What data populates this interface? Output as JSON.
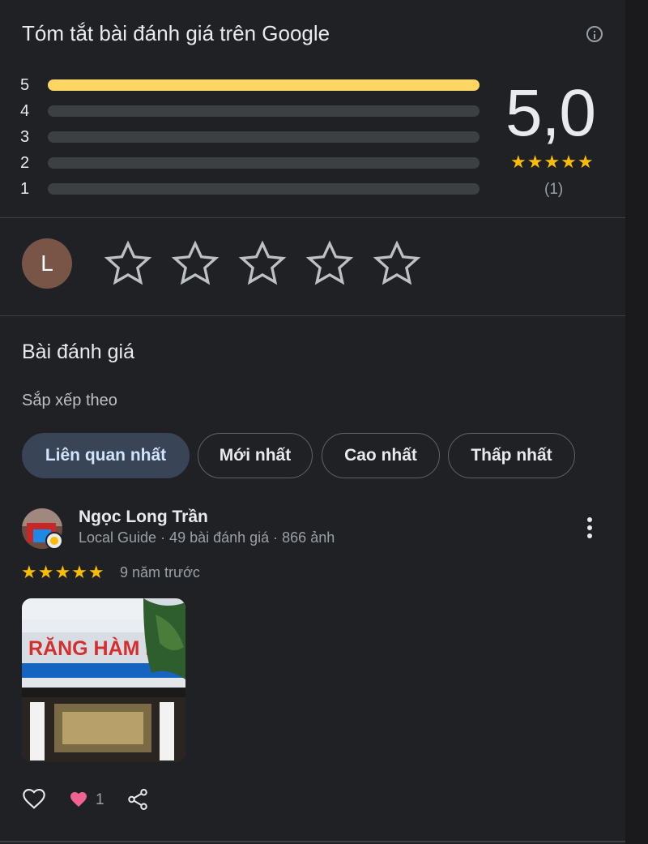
{
  "summary": {
    "title": "Tóm tắt bài đánh giá trên Google",
    "score": "5,0",
    "stars": "★★★★★",
    "count": "(1)",
    "distribution": [
      {
        "label": "5",
        "fill": 1.0
      },
      {
        "label": "4",
        "fill": 0.0
      },
      {
        "label": "3",
        "fill": 0.0
      },
      {
        "label": "2",
        "fill": 0.0
      },
      {
        "label": "1",
        "fill": 0.0
      }
    ]
  },
  "rate": {
    "avatar_letter": "L",
    "star_count": 5
  },
  "reviews_section": {
    "title": "Bài đánh giá",
    "sort_label": "Sắp xếp theo",
    "chips": [
      {
        "label": "Liên quan nhất",
        "active": true
      },
      {
        "label": "Mới nhất",
        "active": false
      },
      {
        "label": "Cao nhất",
        "active": false
      },
      {
        "label": "Thấp nhất",
        "active": false
      }
    ]
  },
  "review": {
    "name": "Ngọc Long Trần",
    "meta": "Local Guide · 49 bài đánh giá · 866 ảnh",
    "stars": "★★★★★",
    "time": "9 năm trước",
    "photo_sign_text": "RĂNG HÀM MẶT",
    "like_count": "1"
  },
  "colors": {
    "background": "#202124",
    "star": "#fbbc04",
    "bar_fill": "#fdd663",
    "bar_track": "#3c4043",
    "active_chip": "#394457",
    "heart": "#f06292"
  },
  "icons": [
    "info-icon",
    "empty-star-icon",
    "more-vert-icon",
    "like-heart-outline-icon",
    "heart-reaction-icon",
    "share-icon"
  ]
}
